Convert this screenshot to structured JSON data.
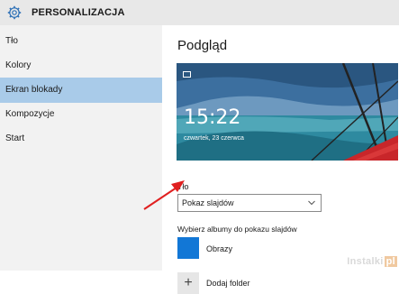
{
  "header": {
    "title": "PERSONALIZACJA",
    "icon": "gear-icon"
  },
  "sidebar": {
    "items": [
      {
        "label": "Tło",
        "active": false
      },
      {
        "label": "Kolory",
        "active": false
      },
      {
        "label": "Ekran blokady",
        "active": true
      },
      {
        "label": "Kompozycje",
        "active": false
      },
      {
        "label": "Start",
        "active": false
      }
    ]
  },
  "main": {
    "title": "Podgląd",
    "preview": {
      "time": "15:22",
      "date": "czwartek, 23 czerwca"
    },
    "background_label": "Tło",
    "background_select": {
      "value": "Pokaz slajdów"
    },
    "albums_label": "Wybierz albumy do pokazu slajdów",
    "albums": [
      {
        "name": "Obrazy",
        "color": "#1277d6"
      }
    ],
    "add_folder_label": "Dodaj folder"
  },
  "watermark": {
    "text": "Instalki",
    "badge": "pl"
  },
  "colors": {
    "active_nav": "#a9cbe9",
    "header_bg": "#e8e8e8",
    "sidebar_bg": "#f2f2f2",
    "accent_tile": "#1277d6",
    "annotation_arrow": "#e02020"
  }
}
